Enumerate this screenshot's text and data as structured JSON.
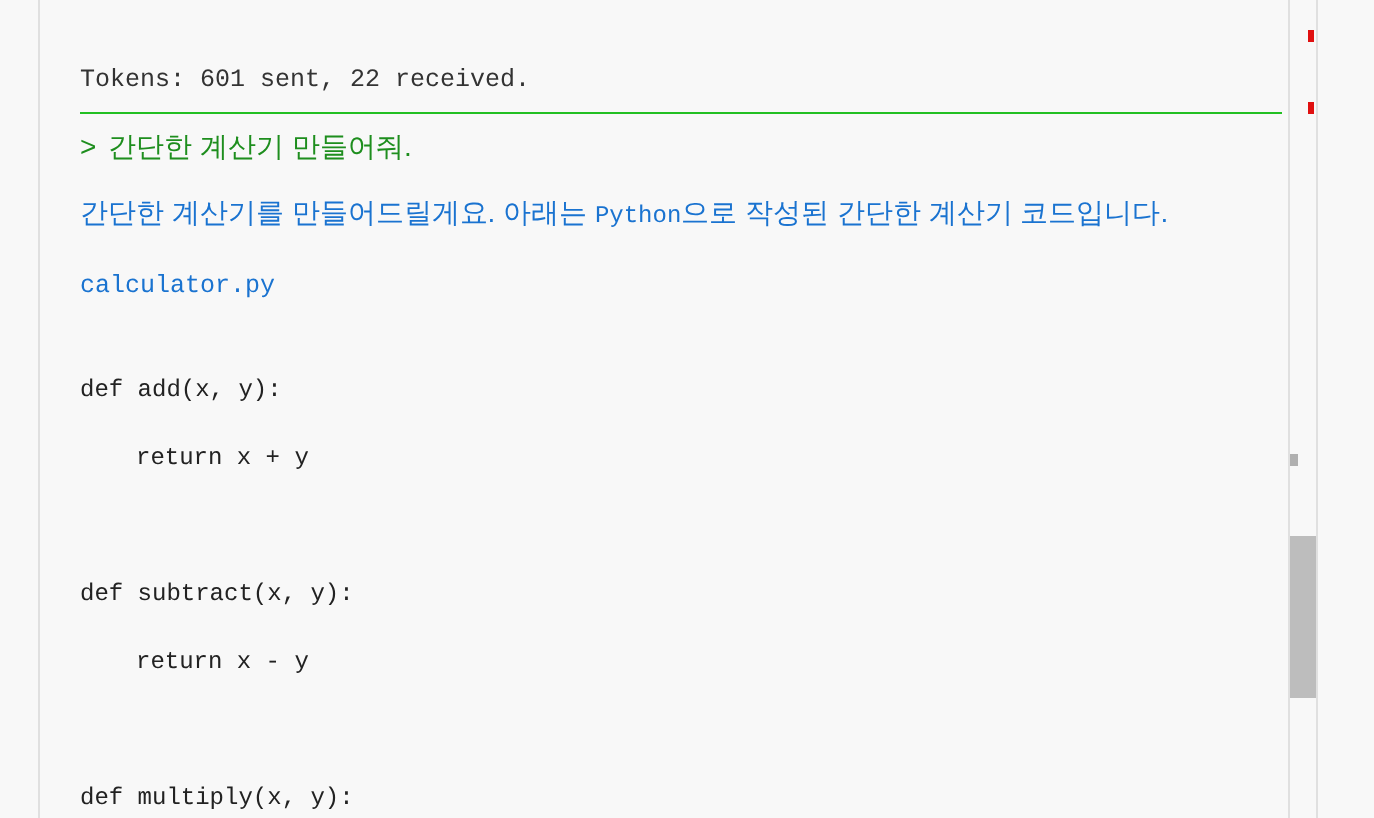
{
  "tokens_line": "Tokens: 601 sent, 22 received.",
  "prompt": {
    "marker": ">",
    "text": "간단한 계산기 만들어줘."
  },
  "reply": {
    "before": "간단한 계산기를 만들어드릴게요. 아래는 ",
    "code_word": "Python",
    "after": "으로 작성된 간단한 계산기 코드입니다."
  },
  "filename": "calculator.py",
  "code_lines": [
    {
      "kind": "def",
      "text": "def add(x, y):"
    },
    {
      "kind": "body",
      "text": "return x + y"
    },
    {
      "kind": "def",
      "text": "def subtract(x, y):"
    },
    {
      "kind": "body",
      "text": "return x - y"
    },
    {
      "kind": "def",
      "text": "def multiply(x, y):"
    }
  ]
}
